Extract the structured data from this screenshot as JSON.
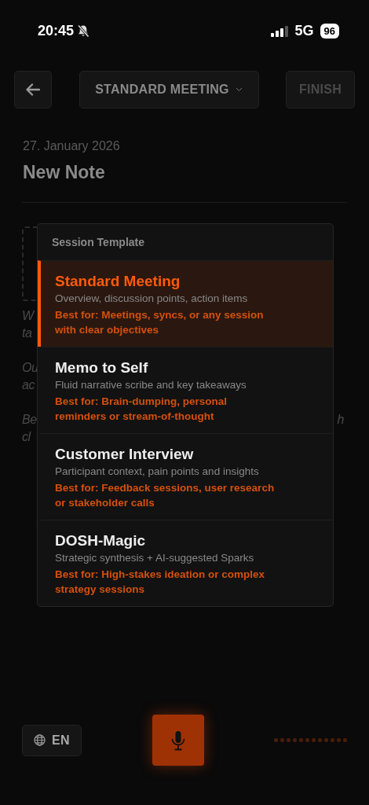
{
  "status_bar": {
    "time": "20:45",
    "network": "5G",
    "battery": "96"
  },
  "header": {
    "template_button": "STANDARD MEETING",
    "finish_button": "FINISH",
    "finish_disabled": true
  },
  "note": {
    "date": "27. January 2026",
    "title": "New Note"
  },
  "hint_fragments": [
    {
      "left": "W"
    },
    {
      "left": "ta"
    },
    {
      "left": "Ou"
    },
    {
      "left": "ac"
    },
    {
      "left": "Be",
      "right": "h"
    },
    {
      "left": "cl"
    }
  ],
  "template_menu": {
    "heading": "Session Template",
    "items": [
      {
        "title": "Standard Meeting",
        "description": "Overview, discussion points, action items",
        "best_for": "Best for: Meetings, syncs, or any session with clear objectives",
        "selected": true
      },
      {
        "title": "Memo to Self",
        "description": "Fluid narrative scribe and key takeaways",
        "best_for": "Best for: Brain-dumping, personal reminders or stream-of-thought",
        "selected": false
      },
      {
        "title": "Customer Interview",
        "description": "Participant context, pain points and insights",
        "best_for": "Best for: Feedback sessions, user research or stakeholder calls",
        "selected": false
      },
      {
        "title": "DOSH-Magic",
        "description": "Strategic synthesis + AI-suggested Sparks",
        "best_for": "Best for: High-stakes ideation or complex strategy sessions",
        "selected": false
      }
    ]
  },
  "bottom_bar": {
    "language_button": "EN",
    "recording": false
  }
}
